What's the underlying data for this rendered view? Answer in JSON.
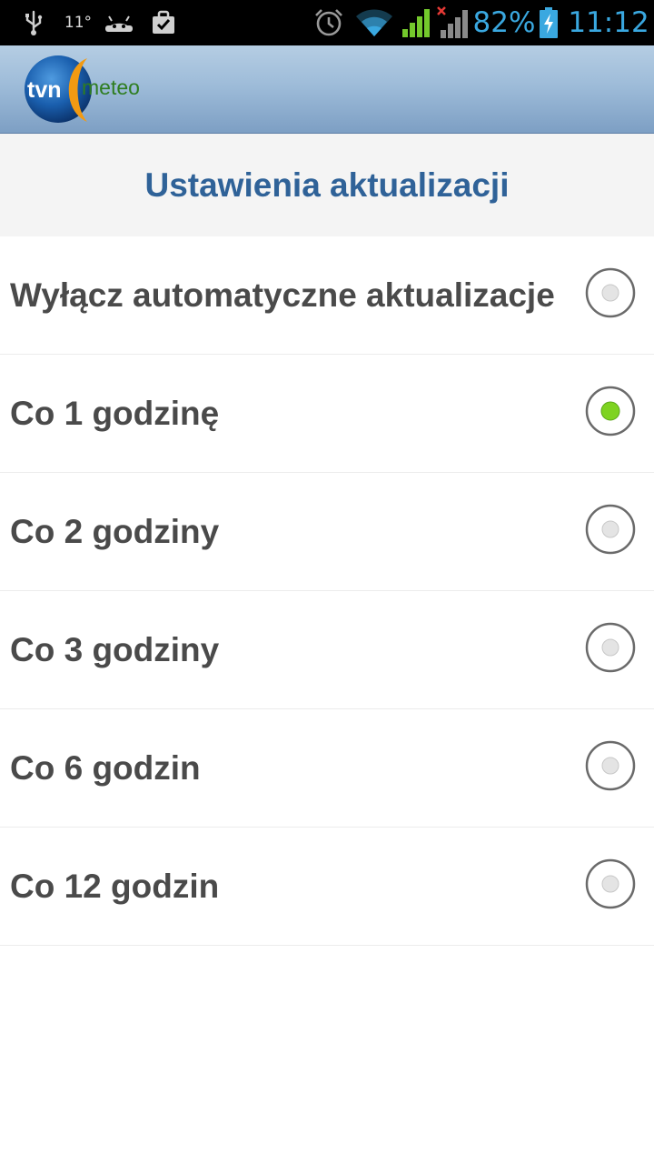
{
  "status_bar": {
    "temperature": "11°",
    "battery_percent": "82%",
    "clock": "11:12",
    "icons": [
      "usb-icon",
      "android-icon",
      "briefcase-check-icon",
      "alarm-icon",
      "wifi-icon",
      "signal-icon",
      "signal-no-sim-icon",
      "battery-charging-icon"
    ],
    "accent_color": "#3aa8e0"
  },
  "header": {
    "logo_text_left": "tvn",
    "logo_text_right": "meteo"
  },
  "page": {
    "title": "Ustawienia aktualizacji"
  },
  "options": [
    {
      "label": "Wyłącz automatyczne aktualizacje",
      "selected": false
    },
    {
      "label": "Co 1 godzinę",
      "selected": true
    },
    {
      "label": "Co 2 godziny",
      "selected": false
    },
    {
      "label": "Co 3 godziny",
      "selected": false
    },
    {
      "label": "Co 6 godzin",
      "selected": false
    },
    {
      "label": "Co 12 godzin",
      "selected": false
    }
  ],
  "colors": {
    "title": "#2f6298",
    "option_text": "#4a4a4a",
    "radio_selected": "#7ed321"
  }
}
